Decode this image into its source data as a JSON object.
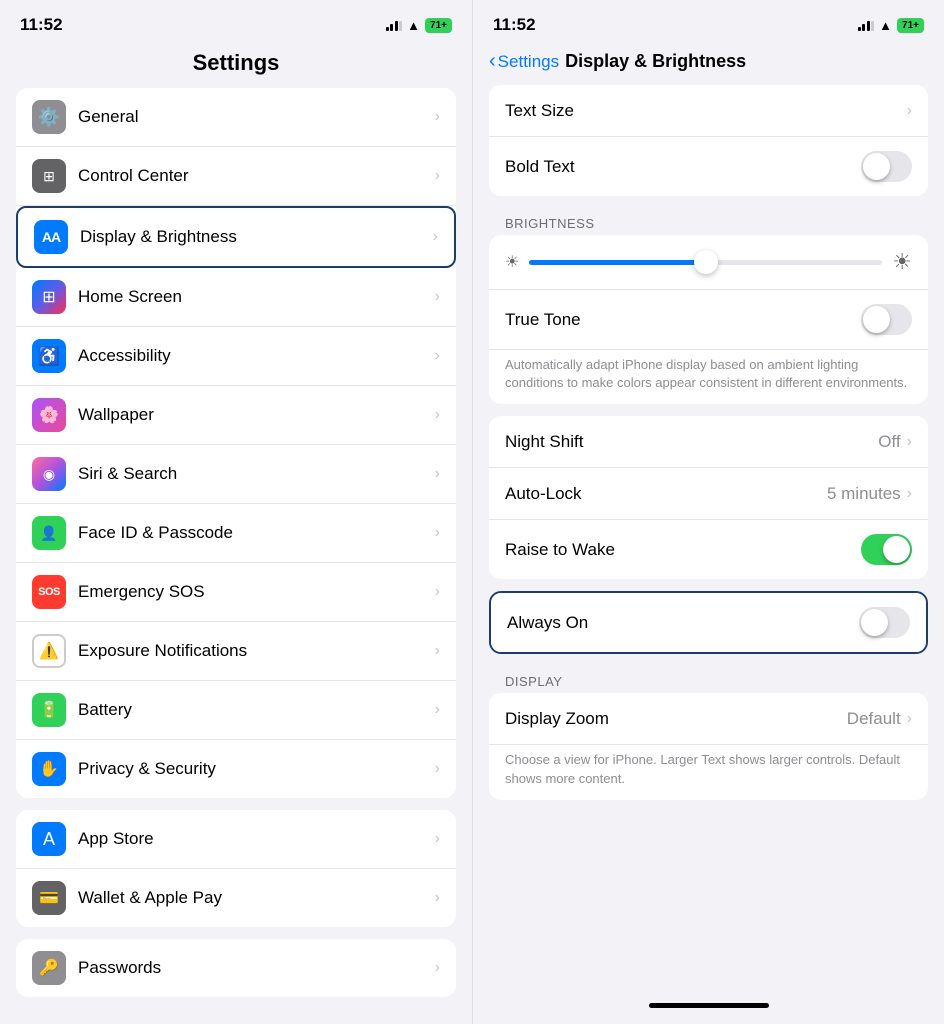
{
  "left": {
    "status": {
      "time": "11:52",
      "battery": "71+"
    },
    "title": "Settings",
    "items": [
      {
        "id": "general",
        "label": "General",
        "icon": "⚙️",
        "iconClass": "icon-gray",
        "iconText": "⚙️"
      },
      {
        "id": "control-center",
        "label": "Control Center",
        "icon": "🎛",
        "iconClass": "icon-dark-gray",
        "iconText": "🎛"
      },
      {
        "id": "display-brightness",
        "label": "Display & Brightness",
        "icon": "AA",
        "iconClass": "icon-blue",
        "highlighted": true
      },
      {
        "id": "home-screen",
        "label": "Home Screen",
        "iconClass": "icon-multicolor",
        "iconText": "⊞"
      },
      {
        "id": "accessibility",
        "label": "Accessibility",
        "iconClass": "icon-blue",
        "iconText": "♿"
      },
      {
        "id": "wallpaper",
        "label": "Wallpaper",
        "iconClass": "icon-purple",
        "iconText": "🖼"
      },
      {
        "id": "siri-search",
        "label": "Siri & Search",
        "iconClass": "icon-pink",
        "iconText": "◉"
      },
      {
        "id": "face-id",
        "label": "Face ID & Passcode",
        "iconClass": "icon-green",
        "iconText": "👤"
      },
      {
        "id": "emergency-sos",
        "label": "Emergency SOS",
        "iconClass": "icon-orange",
        "iconText": "SOS"
      },
      {
        "id": "exposure",
        "label": "Exposure Notifications",
        "iconClass": "icon-yellow",
        "iconText": "⚠"
      },
      {
        "id": "battery",
        "label": "Battery",
        "iconClass": "icon-green",
        "iconText": "🔋"
      },
      {
        "id": "privacy",
        "label": "Privacy & Security",
        "iconClass": "icon-blue",
        "iconText": "✋"
      }
    ],
    "section2": [
      {
        "id": "app-store",
        "label": "App Store",
        "iconClass": "icon-blue",
        "iconText": "A"
      },
      {
        "id": "wallet",
        "label": "Wallet & Apple Pay",
        "iconClass": "icon-dark-gray",
        "iconText": "💳"
      }
    ],
    "section3": [
      {
        "id": "passwords",
        "label": "Passwords",
        "iconClass": "icon-gray",
        "iconText": "🔑"
      }
    ]
  },
  "right": {
    "status": {
      "time": "11:52",
      "battery": "71+"
    },
    "back_label": "Settings",
    "title": "Display & Brightness",
    "items": [
      {
        "id": "text-size",
        "label": "Text Size",
        "type": "chevron"
      },
      {
        "id": "bold-text",
        "label": "Bold Text",
        "type": "toggle",
        "value": false
      }
    ],
    "brightness_section_label": "BRIGHTNESS",
    "brightness_value": 50,
    "brightness_items": [
      {
        "id": "true-tone",
        "label": "True Tone",
        "type": "toggle",
        "value": false
      },
      {
        "id": "true-tone-desc",
        "label": "Automatically adapt iPhone display based on ambient lighting conditions to make colors appear consistent in different environments.",
        "type": "description"
      }
    ],
    "other_items": [
      {
        "id": "night-shift",
        "label": "Night Shift",
        "value": "Off",
        "type": "chevron"
      },
      {
        "id": "auto-lock",
        "label": "Auto-Lock",
        "value": "5 minutes",
        "type": "chevron"
      },
      {
        "id": "raise-to-wake",
        "label": "Raise to Wake",
        "type": "toggle",
        "value": true
      }
    ],
    "always_on_item": {
      "id": "always-on",
      "label": "Always On",
      "type": "toggle",
      "value": false,
      "highlighted": true
    },
    "display_section_label": "DISPLAY",
    "display_items": [
      {
        "id": "display-zoom",
        "label": "Display Zoom",
        "value": "Default",
        "type": "chevron"
      },
      {
        "id": "display-zoom-desc",
        "label": "Choose a view for iPhone. Larger Text shows larger controls. Default shows more content.",
        "type": "description"
      }
    ]
  }
}
